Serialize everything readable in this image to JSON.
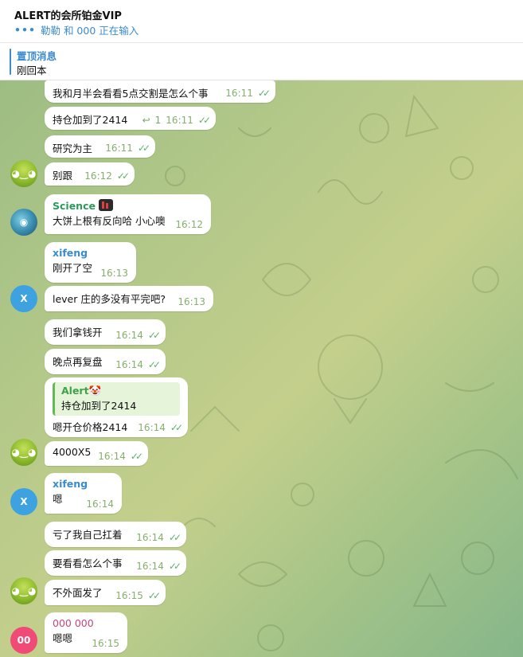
{
  "header": {
    "title": "ALERT的会所铂金VIP",
    "typing_dots": "•••",
    "typing_text": "勒勒 和 000 正在输入"
  },
  "pinned": {
    "label": "置顶消息",
    "text": "刚回本"
  },
  "colors": {
    "accent": "#3a8bd0",
    "check": "#5fb16b",
    "sender_green": "#2d9a59",
    "sender_blue": "#3a8bd0",
    "sender_magenta": "#c8467a"
  },
  "messages": [
    {
      "text": "我和月半会看看5点交割是怎么个事",
      "time": "16:11"
    },
    {
      "text": "持仓加到了2414",
      "time": "16:11",
      "reply_count": "1",
      "reply_icon": "reply-arrow-icon"
    },
    {
      "text": "研究为主",
      "time": "16:11"
    },
    {
      "text": "别跟",
      "time": "16:12"
    },
    {
      "sender": "Science",
      "text": "大饼上根有反向哈 小心噢",
      "time": "16:12"
    },
    {
      "sender": "xifeng",
      "text": "刚开了空",
      "time": "16:13"
    },
    {
      "text": "lever 庄的多没有平完吧?",
      "time": "16:13"
    },
    {
      "text": "我们拿钱开",
      "time": "16:14"
    },
    {
      "text": "晚点再复盘",
      "time": "16:14"
    },
    {
      "quote_name": "Alert🤡",
      "quote_text": "持仓加到了2414",
      "text": "嗯开仓价格2414",
      "time": "16:14"
    },
    {
      "text": "4000X5",
      "time": "16:14"
    },
    {
      "sender": "xifeng",
      "text": "嗯",
      "time": "16:14"
    },
    {
      "text": "亏了我自己扛着",
      "time": "16:14"
    },
    {
      "text": "要看看怎么个事",
      "time": "16:14"
    },
    {
      "text": "不外面发了",
      "time": "16:15"
    },
    {
      "sender": "000 000",
      "text": "嗯嗯",
      "time": "16:15"
    }
  ],
  "avatars": {
    "blue_initial": "X",
    "pink_initial": "00"
  }
}
